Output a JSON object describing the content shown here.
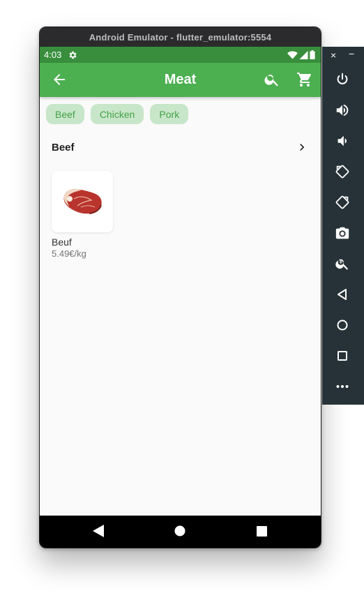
{
  "window": {
    "title": "Android Emulator - flutter_emulator:5554"
  },
  "status_bar": {
    "time": "4:03",
    "icons": [
      "settings-icon",
      "wifi-icon",
      "signal-icon",
      "battery-icon"
    ]
  },
  "app_bar": {
    "title": "Meat",
    "back_icon": "arrow-back-icon",
    "search_icon": "search-icon",
    "cart_icon": "shopping-cart-icon"
  },
  "chips": [
    {
      "label": "Beef"
    },
    {
      "label": "Chicken"
    },
    {
      "label": "Pork"
    }
  ],
  "section": {
    "title": "Beef",
    "more_icon": "chevron-right-icon"
  },
  "products": [
    {
      "name": "Beuf",
      "price": "5.49€/kg",
      "image": "beef-steak"
    }
  ],
  "nav_bar": {
    "buttons": [
      "back-triangle-icon",
      "home-circle-icon",
      "recents-square-icon"
    ]
  },
  "emulator_panel": {
    "close_label": "×",
    "minimize_label": "−",
    "buttons": [
      "power-icon",
      "volume-up-icon",
      "volume-down-icon",
      "rotate-left-icon",
      "rotate-right-icon",
      "camera-icon",
      "zoom-icon",
      "back-icon",
      "home-icon",
      "overview-icon",
      "more-icon"
    ]
  },
  "colors": {
    "primary": "#4caf50",
    "primary_dark": "#388e3c",
    "chip_bg": "#c8e6c9",
    "chip_text": "#43a047",
    "panel": "#263238"
  }
}
